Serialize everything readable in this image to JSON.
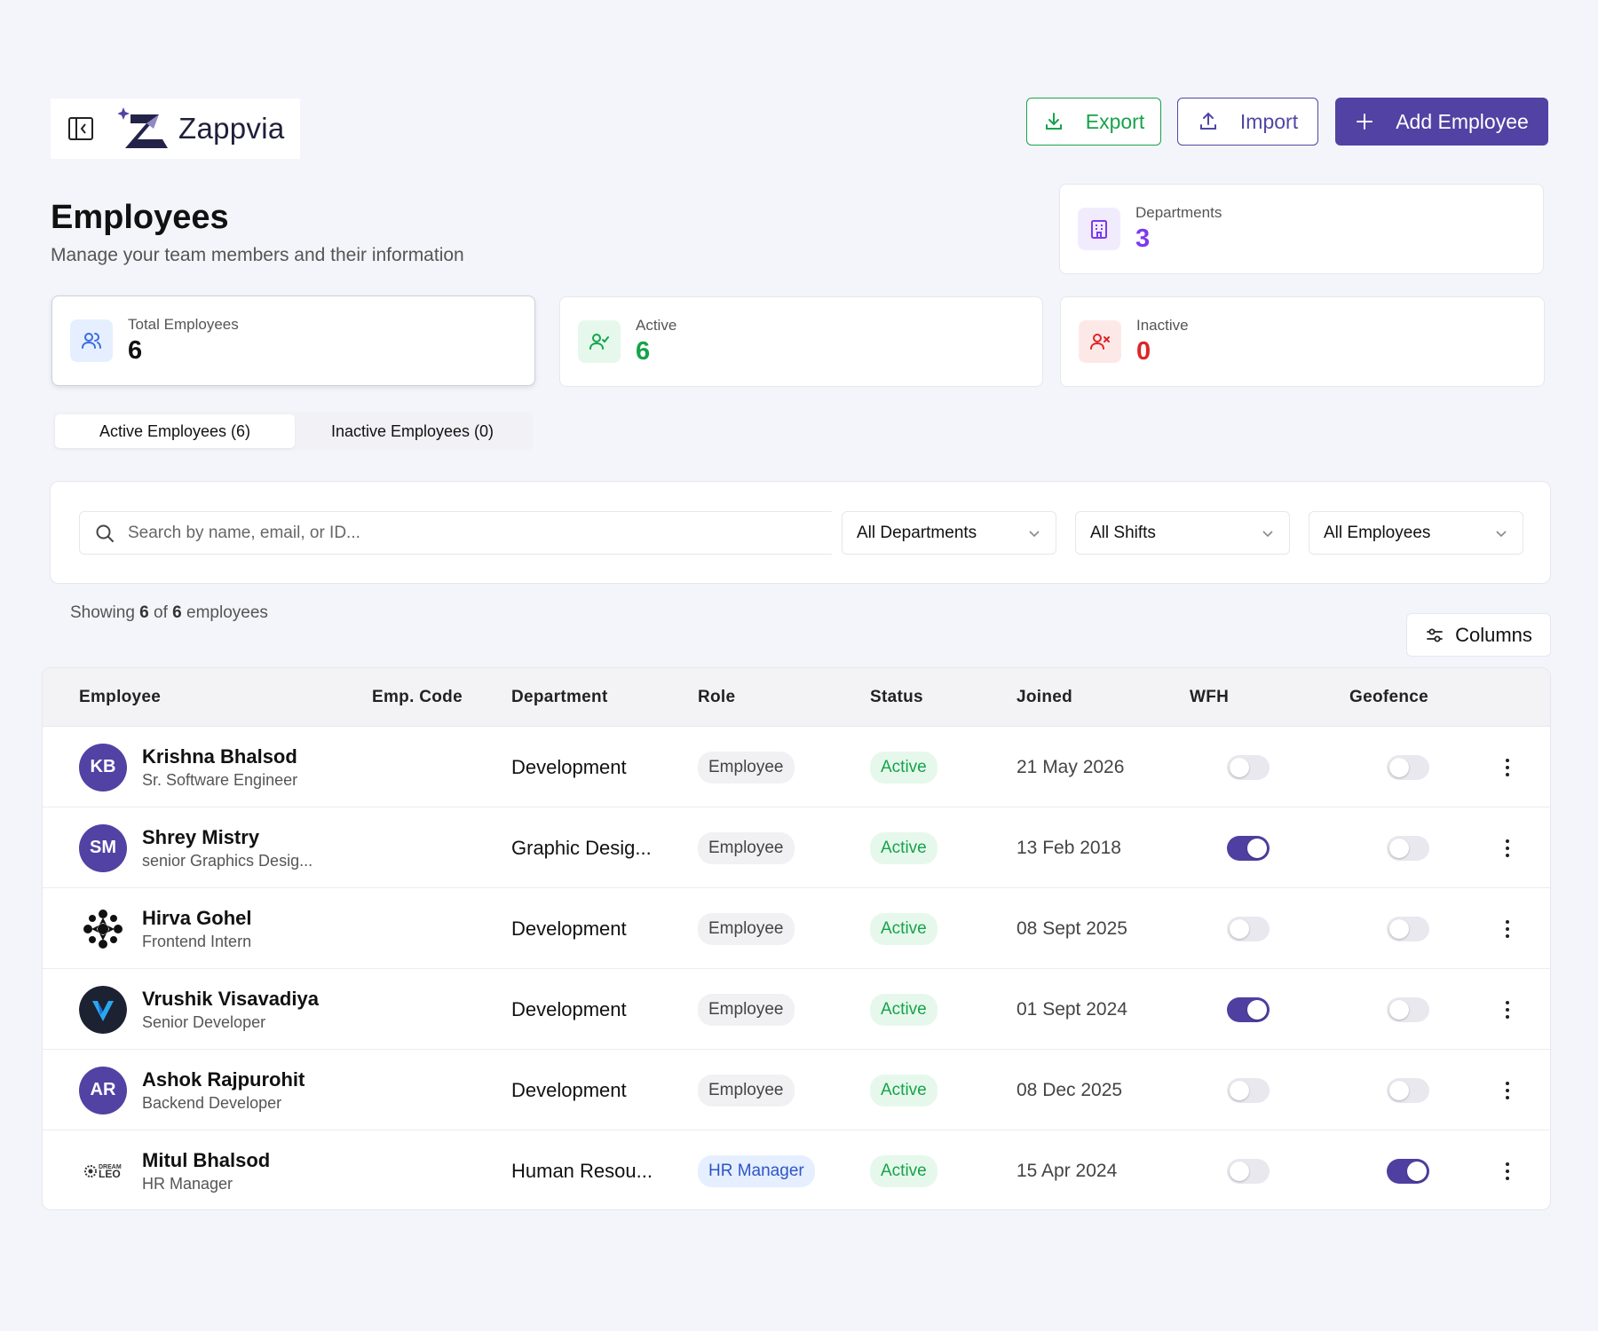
{
  "brand": {
    "name": "Zappvia"
  },
  "actions": {
    "export": "Export",
    "import": "Import",
    "add": "Add Employee"
  },
  "page": {
    "title": "Employees",
    "subtitle": "Manage your team members and their information"
  },
  "stats": {
    "departments": {
      "label": "Departments",
      "value": "3",
      "color": "#7c3aed"
    },
    "total": {
      "label": "Total Employees",
      "value": "6",
      "color": "#111111"
    },
    "active": {
      "label": "Active",
      "value": "6",
      "color": "#16a34a"
    },
    "inactive": {
      "label": "Inactive",
      "value": "0",
      "color": "#dc2626"
    }
  },
  "tabs": {
    "active": "Active Employees (6)",
    "inactive": "Inactive Employees (0)"
  },
  "filters": {
    "search_placeholder": "Search by name, email, or ID...",
    "department": "All Departments",
    "shift": "All Shifts",
    "employees": "All Employees"
  },
  "summary": {
    "prefix": "Showing",
    "shown": "6",
    "of": "of",
    "total": "6",
    "suffix": "employees"
  },
  "columns_button": "Columns",
  "table": {
    "headers": {
      "employee": "Employee",
      "code": "Emp. Code",
      "department": "Department",
      "role": "Role",
      "status": "Status",
      "joined": "Joined",
      "wfh": "WFH",
      "geofence": "Geofence"
    },
    "rows": [
      {
        "initials": "KB",
        "name": "Krishna Bhalsod",
        "title": "Sr. Software Engineer",
        "department": "Development",
        "role": "Employee",
        "status": "Active",
        "joined": "21 May 2026",
        "wfh": false,
        "geofence": false
      },
      {
        "initials": "SM",
        "name": "Shrey Mistry",
        "title": "senior Graphics Desig...",
        "department": "Graphic Desig...",
        "role": "Employee",
        "status": "Active",
        "joined": "13 Feb 2018",
        "wfh": true,
        "geofence": false
      },
      {
        "initials": "",
        "name": "Hirva Gohel",
        "title": "Frontend Intern",
        "department": "Development",
        "role": "Employee",
        "status": "Active",
        "joined": "08 Sept 2025",
        "wfh": false,
        "geofence": false
      },
      {
        "initials": "",
        "name": "Vrushik Visavadiya",
        "title": "Senior Developer",
        "department": "Development",
        "role": "Employee",
        "status": "Active",
        "joined": "01 Sept 2024",
        "wfh": true,
        "geofence": false
      },
      {
        "initials": "AR",
        "name": "Ashok Rajpurohit",
        "title": "Backend Developer",
        "department": "Development",
        "role": "Employee",
        "status": "Active",
        "joined": "08 Dec 2025",
        "wfh": false,
        "geofence": false
      },
      {
        "initials": "",
        "name": "Mitul Bhalsod",
        "title": "HR Manager",
        "department": "Human Resou...",
        "role": "HR Manager",
        "status": "Active",
        "joined": "15 Apr 2024",
        "wfh": false,
        "geofence": true
      }
    ]
  }
}
